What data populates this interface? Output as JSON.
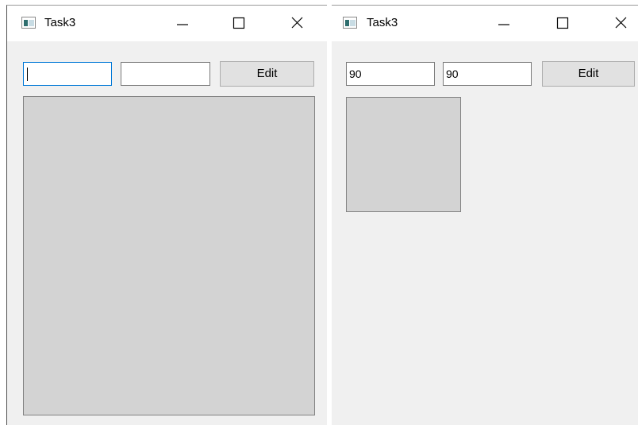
{
  "windows": [
    {
      "title": "Task3",
      "input1": {
        "value": ""
      },
      "input2": {
        "value": ""
      },
      "edit_label": "Edit"
    },
    {
      "title": "Task3",
      "input1": {
        "value": "90"
      },
      "input2": {
        "value": "90"
      },
      "edit_label": "Edit"
    }
  ],
  "icons": {
    "app": "app-window-icon",
    "minimize": "minimize-icon",
    "maximize": "maximize-icon",
    "close": "close-icon"
  },
  "colors": {
    "window_bg": "#f0f0f0",
    "titlebar_bg": "#ffffff",
    "rect_fill": "#d3d3d3",
    "rect_border": "#828282",
    "focus_border": "#0078d7",
    "button_bg": "#e1e1e1"
  }
}
